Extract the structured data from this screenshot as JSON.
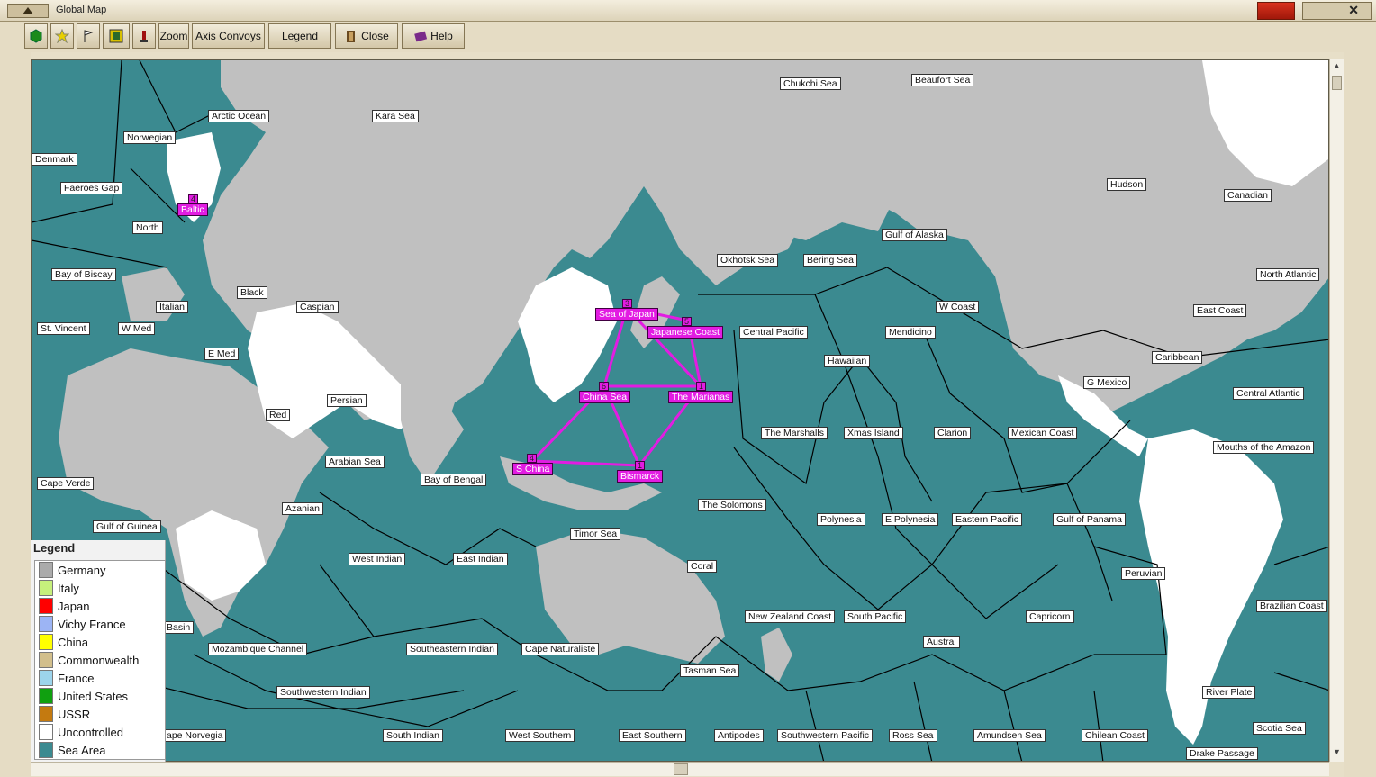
{
  "window": {
    "title": "Global Map"
  },
  "toolbar": {
    "zoom_label": "Zoom",
    "axis_convoys_label": "Axis Convoys",
    "legend_label": "Legend",
    "close_label": "Close",
    "help_label": "Help"
  },
  "legend": {
    "title": "Legend",
    "items": [
      {
        "name": "Germany",
        "color": "#ababab"
      },
      {
        "name": "Italy",
        "color": "#c6f07c"
      },
      {
        "name": "Japan",
        "color": "#ff0000"
      },
      {
        "name": "Vichy France",
        "color": "#9cb4f4"
      },
      {
        "name": "China",
        "color": "#ffff00"
      },
      {
        "name": "Commonwealth",
        "color": "#d2bf8c"
      },
      {
        "name": "France",
        "color": "#9cd4ec"
      },
      {
        "name": "United States",
        "color": "#10a010"
      },
      {
        "name": "USSR",
        "color": "#c47a10"
      },
      {
        "name": "Uncontrolled",
        "color": "#ffffff"
      },
      {
        "name": "Sea Area",
        "color": "#3b8a90"
      }
    ]
  },
  "sea_areas": [
    "Arctic Ocean",
    "Kara Sea",
    "Chukchi Sea",
    "Beaufort Sea",
    "Norwegian",
    "Denmark",
    "Faeroes Gap",
    "Hudson",
    "Canadian",
    "North",
    "Bay of Biscay",
    "Gulf of Alaska",
    "Okhotsk Sea",
    "Bering Sea",
    "North Atlantic",
    "Black",
    "Caspian",
    "Italian",
    "W Coast",
    "East Coast",
    "St. Vincent",
    "W Med",
    "Central Pacific",
    "Mendicino",
    "E Med",
    "Hawaiian",
    "Caribbean",
    "G Mexico",
    "Persian",
    "Central Atlantic",
    "Red",
    "The Marshalls",
    "Xmas Island",
    "Clarion",
    "Mexican Coast",
    "Mouths of the Amazon",
    "Arabian Sea",
    "Bay of Bengal",
    "Cape Verde",
    "Azanian",
    "The Solomons",
    "Gulf of Guinea",
    "Polynesia",
    "E Polynesia",
    "Eastern Pacific",
    "Gulf of Panama",
    "Timor Sea",
    "West Indian",
    "East Indian",
    "Coral",
    "Peruvian",
    "Brazilian Coast",
    "Basin",
    "New Zealand Coast",
    "South Pacific",
    "Capricorn",
    "Austral",
    "Mozambique Channel",
    "Southeastern Indian",
    "Cape Naturaliste",
    "Tasman Sea",
    "Southwestern Indian",
    "River Plate",
    "Scotia Sea",
    "ape Norvegia",
    "South Indian",
    "West Southern",
    "East Southern",
    "Antipodes",
    "Southwestern Pacific",
    "Ross Sea",
    "Amundsen Sea",
    "Chilean Coast",
    "Drake Passage"
  ],
  "highlighted_areas": [
    {
      "name": "Baltic",
      "count": "4"
    },
    {
      "name": "Sea of Japan",
      "count": "3"
    },
    {
      "name": "Japanese Coast",
      "count": "5"
    },
    {
      "name": "China Sea",
      "count": "6"
    },
    {
      "name": "The Marianas",
      "count": "1"
    },
    {
      "name": "S China",
      "count": "4"
    },
    {
      "name": "Bismarck",
      "count": "1"
    }
  ],
  "colors": {
    "sea": "#3b8a90",
    "axis_land": "#c0c0c0",
    "uncontrolled_land": "#ffffff",
    "route": "#e21ce2"
  }
}
